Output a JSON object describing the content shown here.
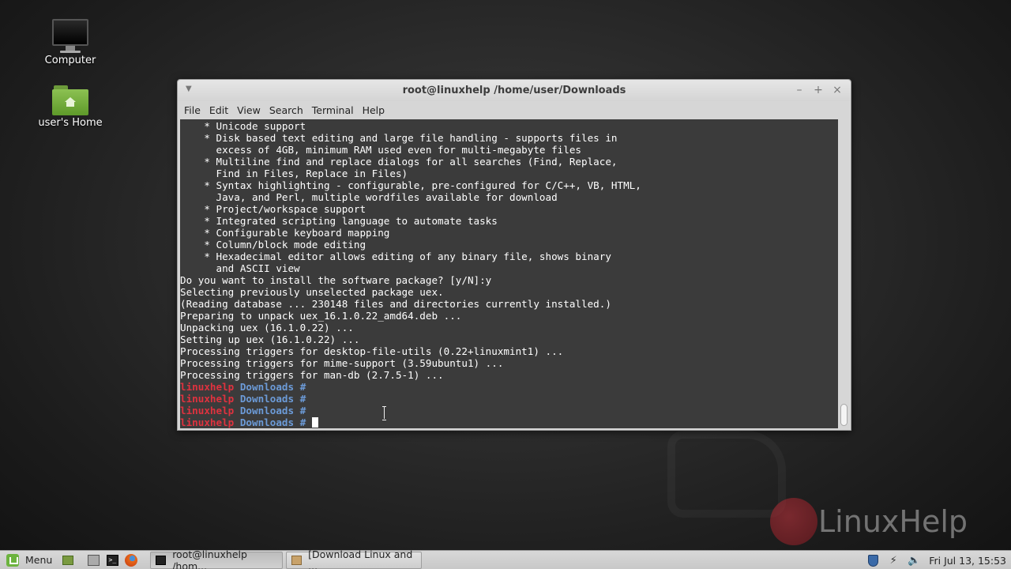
{
  "desktop": {
    "icons": [
      {
        "label": "Computer"
      },
      {
        "label": "user's Home"
      }
    ]
  },
  "watermark": {
    "text": "LinuxHelp"
  },
  "window": {
    "title": "root@linuxhelp /home/user/Downloads",
    "menu": [
      "File",
      "Edit",
      "View",
      "Search",
      "Terminal",
      "Help"
    ],
    "controls": {
      "minimize": "–",
      "maximize": "+",
      "close": "×"
    }
  },
  "terminal": {
    "lines": [
      "    * Unicode support",
      "    * Disk based text editing and large file handling - supports files in",
      "      excess of 4GB, minimum RAM used even for multi-megabyte files",
      "    * Multiline find and replace dialogs for all searches (Find, Replace,",
      "      Find in Files, Replace in Files)",
      "    * Syntax highlighting - configurable, pre-configured for C/C++, VB, HTML,",
      "      Java, and Perl, multiple wordfiles available for download",
      "    * Project/workspace support",
      "    * Integrated scripting language to automate tasks",
      "    * Configurable keyboard mapping",
      "    * Column/block mode editing",
      "    * Hexadecimal editor allows editing of any binary file, shows binary",
      "      and ASCII view",
      "Do you want to install the software package? [y/N]:y",
      "Selecting previously unselected package uex.",
      "(Reading database ... 230148 files and directories currently installed.)",
      "Preparing to unpack uex_16.1.0.22_amd64.deb ...",
      "Unpacking uex (16.1.0.22) ...",
      "Setting up uex (16.1.0.22) ...",
      "Processing triggers for desktop-file-utils (0.22+linuxmint1) ...",
      "Processing triggers for mime-support (3.59ubuntu1) ...",
      "Processing triggers for man-db (2.7.5-1) ..."
    ],
    "prompt": {
      "host": "linuxhelp",
      "dir": "Downloads",
      "symbol": "#"
    },
    "prompt_count": 4,
    "colors": {
      "background": "#3b3b3b",
      "host": "#e0323f",
      "dir": "#6c9bd8",
      "text": "#ffffff"
    }
  },
  "taskbar": {
    "menu_label": "Menu",
    "tasks": [
      {
        "label": "root@linuxhelp /hom..."
      },
      {
        "label": "[Download Linux and ..."
      }
    ],
    "clock": "Fri Jul 13, 15:53",
    "icons": [
      "show-desktop-icon",
      "file-manager-icon",
      "terminal-icon",
      "firefox-icon",
      "shield-icon",
      "network-icon",
      "volume-icon"
    ]
  }
}
